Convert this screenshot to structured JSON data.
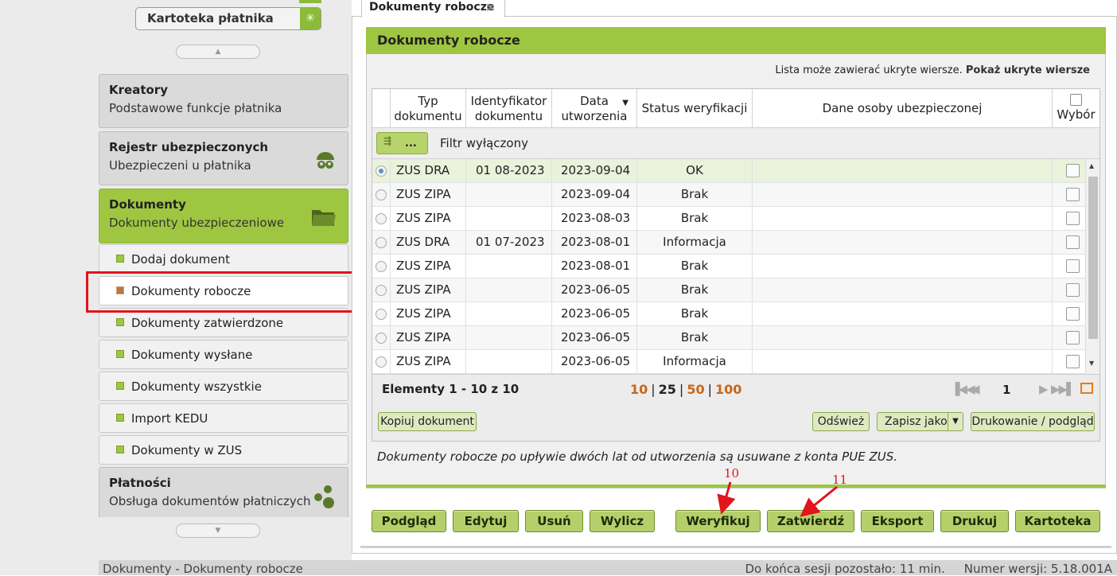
{
  "sidebar": {
    "kartoteka_button": "Kartoteka płatnika",
    "sections": [
      {
        "title": "Kreatory",
        "subtitle": "Podstawowe funkcje płatnika"
      },
      {
        "title": "Rejestr ubezpieczonych",
        "subtitle": "Ubezpieczeni u płatnika",
        "icon": "people-icon"
      },
      {
        "title": "Dokumenty",
        "subtitle": "Dokumenty ubezpieczeniowe",
        "icon": "folder-icon",
        "active": true
      },
      {
        "title": "Płatności",
        "subtitle": "Obsługa dokumentów płatniczych",
        "icon": "coins-icon"
      }
    ],
    "subitems": [
      "Dodaj dokument",
      "Dokumenty robocze",
      "Dokumenty zatwierdzone",
      "Dokumenty wysłane",
      "Dokumenty wszystkie",
      "Import KEDU",
      "Dokumenty w ZUS"
    ],
    "selected_subitem": "Dokumenty robocze"
  },
  "tab": {
    "label": "Dokumenty robocze",
    "close": "×"
  },
  "panel": {
    "title": "Dokumenty robocze",
    "hidden_note": "Lista może zawierać ukryte wiersze.",
    "hidden_link": "Pokaż ukryte wiersze"
  },
  "table": {
    "headers": {
      "typ": "Typ dokumentu",
      "typ_l1": "Typ",
      "typ_l2": "dokumentu",
      "id_l1": "Identyfikator",
      "id_l2": "dokumentu",
      "data_l1": "Data",
      "data_l2": "utworzenia",
      "status": "Status weryfikacji",
      "dane": "Dane osoby ubezpieczonej",
      "wybor": "Wybór"
    },
    "filter_button": "...",
    "filter_label": "Filtr wyłączony",
    "rows": [
      {
        "typ": "ZUS DRA",
        "id": "01 08-2023",
        "data": "2023-09-04",
        "status": "OK",
        "selected": true
      },
      {
        "typ": "ZUS ZIPA",
        "id": "",
        "data": "2023-09-04",
        "status": "Brak"
      },
      {
        "typ": "ZUS ZIPA",
        "id": "",
        "data": "2023-08-03",
        "status": "Brak"
      },
      {
        "typ": "ZUS DRA",
        "id": "01 07-2023",
        "data": "2023-08-01",
        "status": "Informacja"
      },
      {
        "typ": "ZUS ZIPA",
        "id": "",
        "data": "2023-08-01",
        "status": "Brak"
      },
      {
        "typ": "ZUS ZIPA",
        "id": "",
        "data": "2023-06-05",
        "status": "Brak"
      },
      {
        "typ": "ZUS ZIPA",
        "id": "",
        "data": "2023-06-05",
        "status": "Brak"
      },
      {
        "typ": "ZUS ZIPA",
        "id": "",
        "data": "2023-06-05",
        "status": "Brak"
      },
      {
        "typ": "ZUS ZIPA",
        "id": "",
        "data": "2023-06-05",
        "status": "Informacja"
      }
    ]
  },
  "pager": {
    "elements": "Elementy 1 - 10 z 10",
    "sizes": [
      "10",
      "25",
      "50",
      "100"
    ],
    "current_size": "25",
    "page": "1"
  },
  "grid_buttons": {
    "copy": "Kopiuj dokument",
    "refresh": "Odśwież",
    "save_as": "Zapisz jako",
    "print": "Drukowanie / podgląd"
  },
  "info_text": "Dokumenty robocze po upływie dwóch lat od utworzenia są usuwane z konta PUE ZUS.",
  "actions": [
    "Podgląd",
    "Edytuj",
    "Usuń",
    "Wylicz",
    "Weryfikuj",
    "Zatwierdź",
    "Eksport",
    "Drukuj",
    "Kartoteka"
  ],
  "annotations": [
    "10",
    "11"
  ],
  "status_bar": {
    "left": "Dokumenty - Dokumenty robocze",
    "session": "Do końca sesji pozostało: 11 min.",
    "version": "Numer wersji: 5.18.001A"
  },
  "colors": {
    "accent_green": "#9fc640",
    "highlight_red": "#e2141c",
    "pager_orange": "#c8661a"
  }
}
